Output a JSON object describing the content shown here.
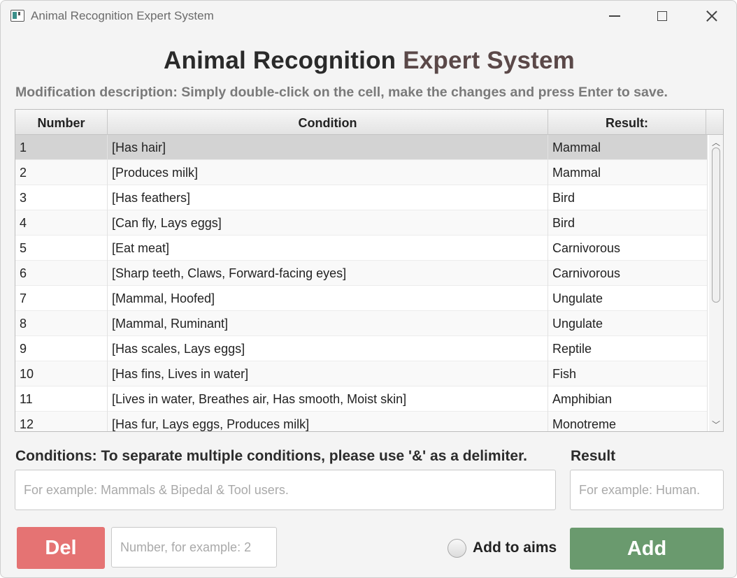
{
  "window": {
    "title": "Animal Recognition Expert System",
    "controls": {
      "minimize": "minimize-icon",
      "maximize": "maximize-icon",
      "close": "close-icon"
    }
  },
  "header": {
    "title_part1": "Animal Recognition",
    "title_part2": "Expert System",
    "description": "Modification description: Simply double-click on the cell, make the changes and press Enter to save."
  },
  "table": {
    "columns": [
      "Number",
      "Condition",
      "Result:"
    ],
    "selected_row": 1,
    "rows": [
      {
        "number": "1",
        "condition": "[Has hair]",
        "result": "Mammal"
      },
      {
        "number": "2",
        "condition": "[Produces milk]",
        "result": "Mammal"
      },
      {
        "number": "3",
        "condition": "[Has feathers]",
        "result": "Bird"
      },
      {
        "number": "4",
        "condition": "[Can fly, Lays eggs]",
        "result": "Bird"
      },
      {
        "number": "5",
        "condition": "[Eat meat]",
        "result": "Carnivorous"
      },
      {
        "number": "6",
        "condition": "[Sharp teeth, Claws, Forward-facing eyes]",
        "result": "Carnivorous"
      },
      {
        "number": "7",
        "condition": "[Mammal, Hoofed]",
        "result": "Ungulate"
      },
      {
        "number": "8",
        "condition": "[Mammal, Ruminant]",
        "result": "Ungulate"
      },
      {
        "number": "9",
        "condition": "[Has scales, Lays eggs]",
        "result": "Reptile"
      },
      {
        "number": "10",
        "condition": "[Has fins, Lives in water]",
        "result": "Fish"
      },
      {
        "number": "11",
        "condition": "[Lives in water, Breathes air, Has smooth, Moist skin]",
        "result": "Amphibian"
      },
      {
        "number": "12",
        "condition": "[Has fur, Lays eggs, Produces milk]",
        "result": "Monotreme"
      }
    ]
  },
  "form": {
    "conditions_label": "Conditions: To separate multiple conditions, please use '&' as a delimiter.",
    "conditions_placeholder": "For example: Mammals & Bipedal & Tool users.",
    "conditions_value": "",
    "result_label": "Result",
    "result_placeholder": "For example: Human.",
    "result_value": "",
    "del_label": "Del",
    "number_placeholder": "Number, for example: 2",
    "number_value": "",
    "aims_label": "Add to aims",
    "aims_checked": false,
    "add_label": "Add"
  },
  "colors": {
    "del_button": "#e57373",
    "add_button": "#6a9a6e",
    "selected_row": "#d3d3d3",
    "description_text": "#7a7a7a",
    "title_accent": "#5a4848"
  }
}
